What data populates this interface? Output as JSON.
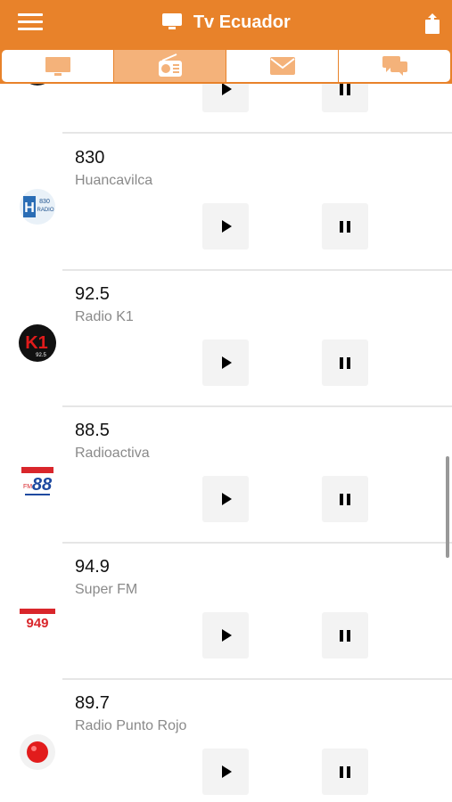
{
  "header": {
    "title": "Tv Ecuador",
    "menu_icon": "hamburger-menu-icon",
    "share_icon": "share-icon",
    "tv_icon": "tv-icon",
    "background": "#e8822a"
  },
  "tabs": [
    {
      "icon": "tv-icon",
      "active": false
    },
    {
      "icon": "radio-icon",
      "active": true
    },
    {
      "icon": "mail-icon",
      "active": false
    },
    {
      "icon": "chat-icon",
      "active": false
    }
  ],
  "stations": [
    {
      "freq": "",
      "name": "",
      "logo": "partial-logo"
    },
    {
      "freq": "830",
      "name": "Huancavilca",
      "logo": "huancavilca-logo"
    },
    {
      "freq": "92.5",
      "name": "Radio K1",
      "logo": "radio-k1-logo"
    },
    {
      "freq": "88.5",
      "name": "Radioactiva",
      "logo": "radioactiva-logo"
    },
    {
      "freq": "94.9",
      "name": "Super FM",
      "logo": "super-fm-logo"
    },
    {
      "freq": "89.7",
      "name": "Radio Punto Rojo",
      "logo": "punto-rojo-logo"
    }
  ]
}
